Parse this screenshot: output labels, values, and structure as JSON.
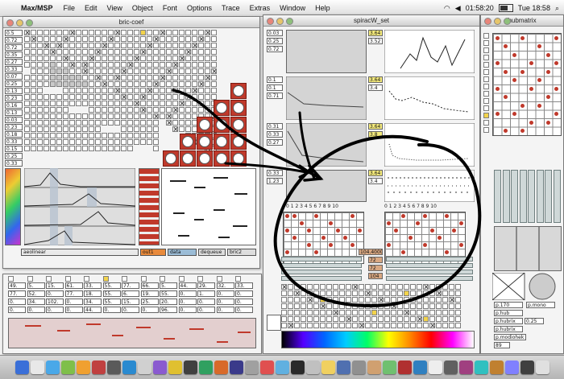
{
  "menubar": {
    "app_name": "Max/MSP",
    "items": [
      "File",
      "Edit",
      "View",
      "Object",
      "Font",
      "Options",
      "Trace",
      "Extras",
      "Window",
      "Help"
    ],
    "clock": "01:58:20",
    "datetime": "Tue 18:58"
  },
  "windows": {
    "bric": {
      "title": "bric-coef",
      "left_numbers": [
        "0.5",
        "0.72",
        "0.72",
        "0.35",
        "0.27",
        "0.33",
        "0.07",
        "0.25",
        "0.13",
        "0.23",
        "0.16",
        "0.13",
        "0.03",
        "0.23",
        "0.18",
        "0.33",
        "0.15",
        "0.25",
        "0.33"
      ],
      "menus": [
        "aeolinear",
        "out1",
        "data",
        "dequeue",
        "bric2"
      ]
    },
    "spirac": {
      "title": "spiracW_set",
      "row1": {
        "left": [
          "0.03",
          "0.25",
          "0.72"
        ],
        "right": [
          "3.64",
          "3.52"
        ]
      },
      "row2": {
        "left": [
          "0.1",
          "0.1",
          "0.71"
        ],
        "right": [
          "3.64",
          "3.4"
        ]
      },
      "row3": {
        "left": [
          "0.31",
          "0.33",
          "0.27"
        ],
        "right": [
          "3.64",
          "3.8"
        ]
      },
      "row4": {
        "left": [
          "0.33",
          "1.23"
        ],
        "right": [
          "3.64",
          "3.4"
        ]
      },
      "axis_ticks": "0 1 2 3 4 5 6 7 8 9 10",
      "value_boxes": [
        "104.4000",
        "72",
        "72",
        "104"
      ]
    },
    "hub": {
      "title": "hubmatrix",
      "labels": [
        "p.170",
        "p.hub",
        "p.hubrix",
        "p.hubrix",
        "p.modiohek",
        "p.mono"
      ],
      "value": "0.25",
      "value2": "89"
    },
    "bottom_left": {
      "row1": [
        "49.",
        "5.",
        "15.",
        "61.",
        "33.",
        "55.",
        "77.",
        "66.",
        "5.",
        "44.",
        "29.",
        "32.",
        "33."
      ],
      "row2": [
        "77.",
        "52.",
        "0.",
        "77.",
        "18.",
        "55.",
        "6.",
        "19.",
        "55.",
        "0.",
        "1.",
        "0.",
        "0."
      ],
      "row3": [
        "0.",
        "34.",
        "102.",
        "0.",
        "34.",
        "55.",
        "15.",
        "25.",
        "20.",
        "0.",
        "0.",
        "0.",
        "0."
      ],
      "row4": [
        "0.",
        "0.",
        "0.",
        "0.",
        "44.",
        "0.",
        "0.",
        "0.",
        "96.",
        "0.",
        "0.",
        "0.",
        "0."
      ]
    }
  },
  "colors": {
    "accent_red": "#c0392b",
    "number_yellow": "#f4ea7c",
    "ink": "#000000"
  },
  "icons": [
    "apple-icon",
    "wifi-icon",
    "volume-icon",
    "battery-icon",
    "spotlight-icon"
  ]
}
